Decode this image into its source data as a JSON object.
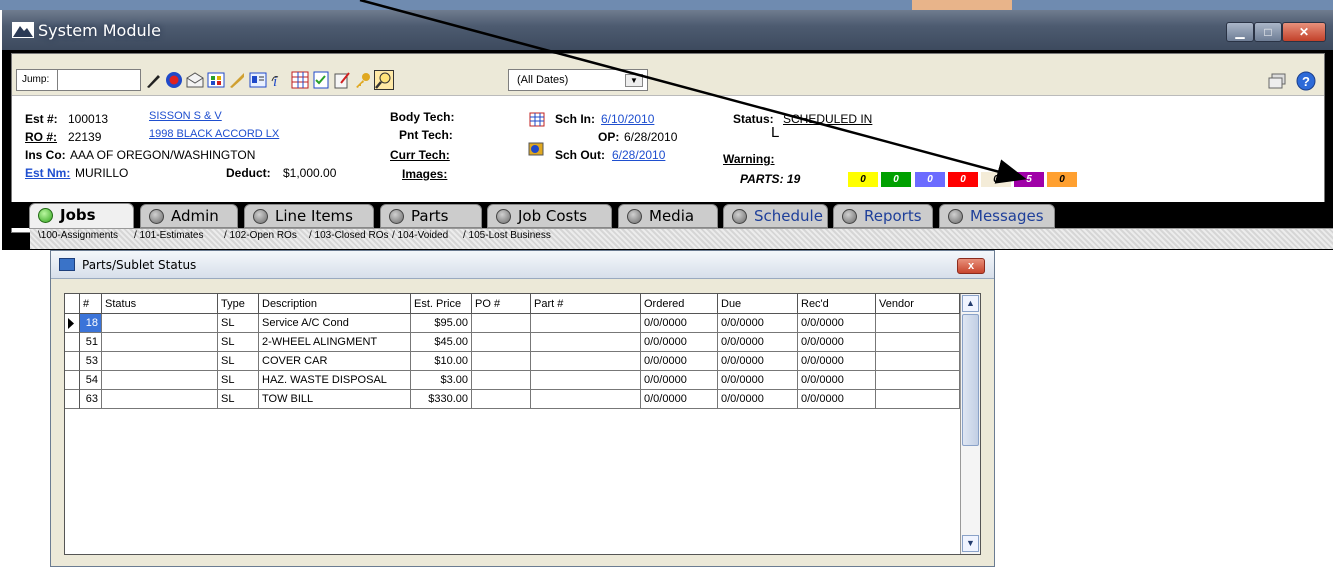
{
  "window": {
    "title": "System Module"
  },
  "toolbar": {
    "jump_label": "Jump:",
    "jump_value": "",
    "dates_value": "(All Dates)",
    "icons": [
      "pen-icon",
      "record-icon",
      "envelope-icon",
      "grid-icon",
      "wrench-icon",
      "card-icon",
      "info-icon",
      "table-icon",
      "checklist-icon",
      "note-icon",
      "key-icon",
      "search-icon"
    ]
  },
  "info": {
    "est_label": "Est #:",
    "est_value": "100013",
    "est_link": "SISSON S & V",
    "ro_label": "RO #:",
    "ro_value": "22139",
    "ro_link": "1998 BLACK ACCORD LX",
    "ins_label": "Ins Co:",
    "ins_value": "AAA OF OREGON/WASHINGTON",
    "estnm_label": "Est Nm:",
    "estnm_value": "MURILLO",
    "deduct_label": "Deduct:",
    "deduct_value": "$1,000.00",
    "body_tech_label": "Body Tech:",
    "pnt_tech_label": "Pnt Tech:",
    "curr_tech_label": "Curr Tech:",
    "images_label": "Images:",
    "schin_label": "Sch In:",
    "schin_value": "6/10/2010",
    "op_label": "OP:",
    "op_value": "6/28/2010",
    "schout_label": "Sch Out:",
    "schout_value": "6/28/2010",
    "status_label": "Status:",
    "status_value": "SCHEDULED IN",
    "status_sub": "L",
    "warning_label": "Warning:",
    "parts_label": "PARTS:",
    "parts_value": "19",
    "parts_boxes": [
      {
        "value": "0",
        "color": "#ffff00"
      },
      {
        "value": "0",
        "color": "#00a000"
      },
      {
        "value": "0",
        "color": "#6b6bff"
      },
      {
        "value": "0",
        "color": "#ff0000"
      },
      {
        "value": "0",
        "color": "#f4ecd8"
      },
      {
        "value": "5",
        "color": "#a000a8"
      },
      {
        "value": "0",
        "color": "#ffa030"
      }
    ]
  },
  "tabs": [
    "Jobs",
    "Admin",
    "Line Items",
    "Parts",
    "Job Costs",
    "Media",
    "Schedule",
    "Reports",
    "Messages"
  ],
  "subtabs": [
    "100-Assignments",
    "101-Estimates",
    "102-Open ROs",
    "103-Closed ROs",
    "104-Voided",
    "105-Lost Business"
  ],
  "dialog": {
    "title": "Parts/Sublet Status",
    "close": "x",
    "columns": [
      "#",
      "Status",
      "Type",
      "Description",
      "Est. Price",
      "PO #",
      "Part #",
      "Ordered",
      "Due",
      "Rec'd",
      "Vendor"
    ],
    "rows": [
      [
        "18",
        "",
        "SL",
        "Service A/C Cond",
        "$95.00",
        "",
        "",
        "0/0/0000",
        "0/0/0000",
        "0/0/0000",
        ""
      ],
      [
        "51",
        "",
        "SL",
        "2-WHEEL ALINGMENT",
        "$45.00",
        "",
        "",
        "0/0/0000",
        "0/0/0000",
        "0/0/0000",
        ""
      ],
      [
        "53",
        "",
        "SL",
        "COVER CAR",
        "$10.00",
        "",
        "",
        "0/0/0000",
        "0/0/0000",
        "0/0/0000",
        ""
      ],
      [
        "54",
        "",
        "SL",
        "HAZ. WASTE DISPOSAL",
        "$3.00",
        "",
        "",
        "0/0/0000",
        "0/0/0000",
        "0/0/0000",
        ""
      ],
      [
        "63",
        "",
        "SL",
        "TOW BILL",
        "$330.00",
        "",
        "",
        "0/0/0000",
        "0/0/0000",
        "0/0/0000",
        ""
      ]
    ]
  }
}
